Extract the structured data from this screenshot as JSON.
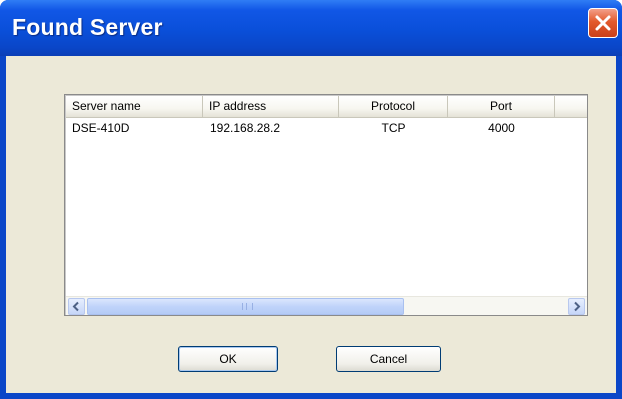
{
  "window": {
    "title": "Found Server"
  },
  "list": {
    "columns": [
      "Server name",
      "IP address",
      "Protocol",
      "Port"
    ],
    "rows": [
      [
        "DSE-410D",
        "192.168.28.2",
        "TCP",
        "4000"
      ]
    ]
  },
  "buttons": {
    "ok": "OK",
    "cancel": "Cancel"
  },
  "icons": {
    "close": "close-icon",
    "scroll_left": "chevron-left-icon",
    "scroll_right": "chevron-right-icon"
  },
  "colors": {
    "titlebar": "#0a46c8",
    "client_bg": "#ece9d8",
    "close_button": "#e35a2c"
  },
  "scrollbar": {
    "visible_fraction": 0.63
  }
}
